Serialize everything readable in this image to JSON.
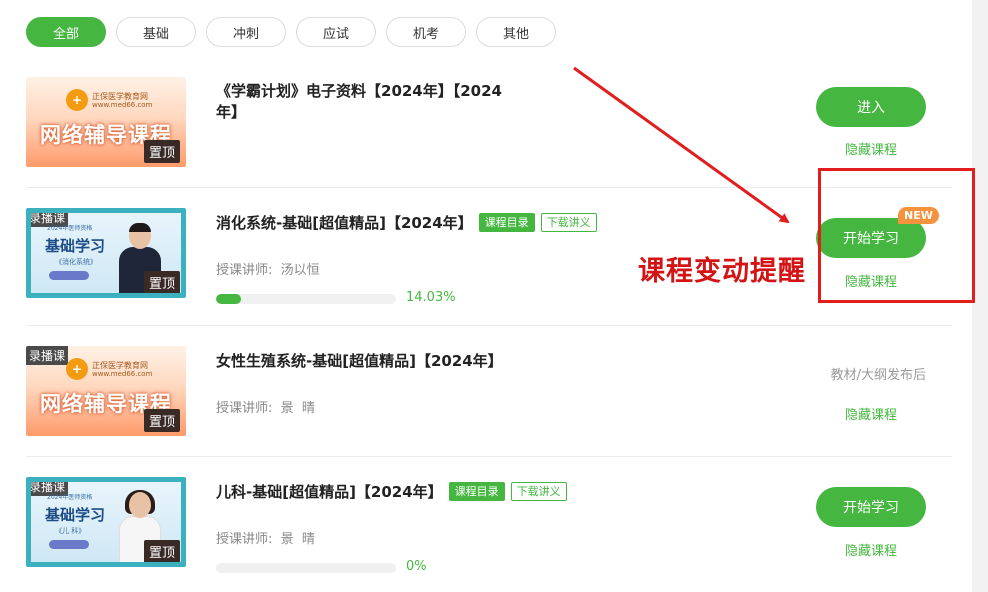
{
  "tabs": [
    "全部",
    "基础",
    "冲刺",
    "应试",
    "机考",
    "其他"
  ],
  "courses": [
    {
      "title": "《学霸计划》电子资料【2024年】【2024年】",
      "title_line1": "《学霸计划》电子资料【2024年】【2024",
      "title_line2": "年】",
      "thumb_logo": "正保医学教育网",
      "thumb_url": "www.med66.com",
      "thumb_banner": "网络辅导课程",
      "pin": "置顶",
      "action": "进入",
      "hide": "隐藏课程"
    },
    {
      "tag": "录播课",
      "title": "消化系统-基础[超值精品]【2024年】",
      "chip_catalog": "课程目录",
      "chip_notes": "下载讲义",
      "teacher_label": "授课讲师:",
      "teacher": "汤以恒",
      "progress": 14.03,
      "progress_text": "14.03%",
      "thumb_sub": "2024年医师资格",
      "thumb_title": "基础学习",
      "thumb_sub2": "《消化系统》",
      "pin": "置顶",
      "action": "开始学习",
      "badge": "NEW",
      "hide": "隐藏课程"
    },
    {
      "tag": "录播课",
      "title": "女性生殖系统-基础[超值精品]【2024年】",
      "teacher_label": "授课讲师:",
      "teacher": "景  晴",
      "thumb_logo": "正保医学教育网",
      "thumb_url": "www.med66.com",
      "thumb_banner": "网络辅导课程",
      "pin": "置顶",
      "status": "教材/大纲发布后",
      "hide": "隐藏课程"
    },
    {
      "tag": "录播课",
      "title": "儿科-基础[超值精品]【2024年】",
      "chip_catalog": "课程目录",
      "chip_notes": "下载讲义",
      "teacher_label": "授课讲师:",
      "teacher": "景  晴",
      "progress": 0,
      "progress_text": "0%",
      "thumb_sub": "2024年医师资格",
      "thumb_title": "基础学习",
      "thumb_sub2": "《儿  科》",
      "pin": "置顶",
      "action": "开始学习",
      "hide": "隐藏课程"
    }
  ],
  "annotation": "课程变动提醒",
  "colors": {
    "accent": "#45b740",
    "annotation": "#e11d1d",
    "badge": "#f5923e"
  }
}
